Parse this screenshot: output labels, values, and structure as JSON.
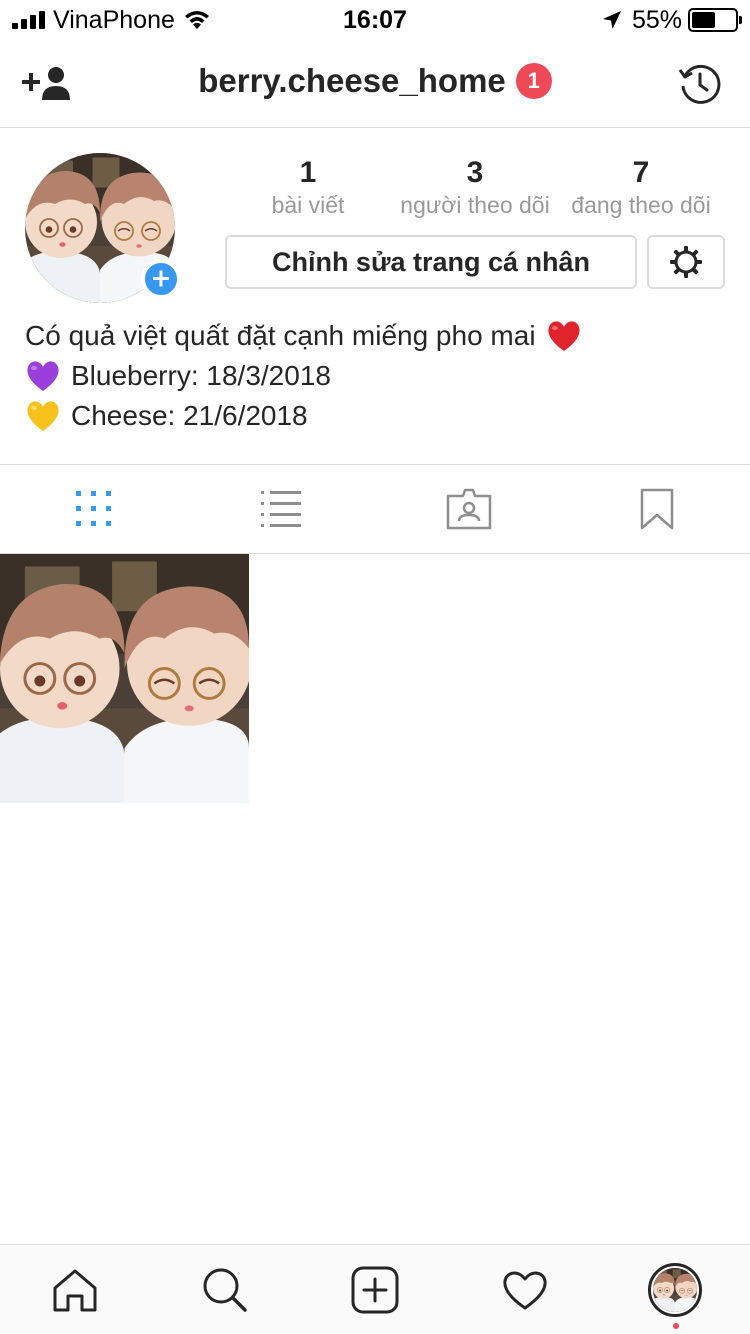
{
  "status_bar": {
    "carrier": "VinaPhone",
    "time": "16:07",
    "battery_percent": "55%",
    "battery_level": 0.55
  },
  "header": {
    "username": "berry.cheese_home",
    "notification_count": "1",
    "left_icon": "add-person-icon",
    "right_icon": "history-icon"
  },
  "profile": {
    "stats": [
      {
        "value": "1",
        "label": "bài viết"
      },
      {
        "value": "3",
        "label": "người theo dõi"
      },
      {
        "value": "7",
        "label": "đang theo dõi"
      }
    ],
    "edit_button_label": "Chỉnh sửa trang cá nhân",
    "bio": {
      "line1": "Có quả việt quất đặt cạnh miếng pho mai",
      "line1_emoji": "❤️",
      "line2_emoji": "💜",
      "line2": "Blueberry: 18/3/2018",
      "line3_emoji": "💛",
      "line3": "Cheese: 21/6/2018"
    }
  },
  "tabs": [
    "grid-icon",
    "list-icon",
    "tagged-icon",
    "bookmark-icon"
  ],
  "bottom_nav": [
    "home-icon",
    "search-icon",
    "new-post-icon",
    "activity-heart-icon",
    "profile-avatar"
  ],
  "colors": {
    "accent": "#3897f0",
    "badge": "#ed4956",
    "text": "#262626",
    "muted": "#999999",
    "border": "#dbdbdb"
  }
}
